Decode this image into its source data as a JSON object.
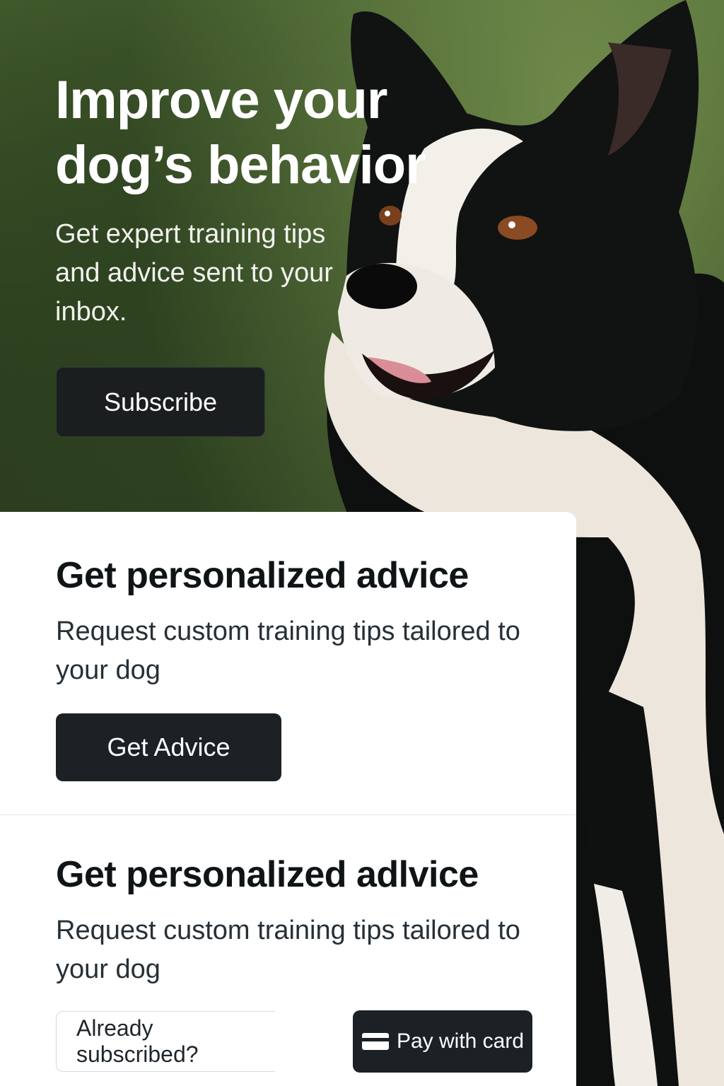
{
  "hero": {
    "title": "Improve your dog’s behavior",
    "subtitle": "Get expert training tips and advice sent to your inbox.",
    "subscribe_label": "Subscribe"
  },
  "advice_section": {
    "title": "Get personalized advice",
    "description": "Request custom training tips tailored to your dog",
    "button_label": "Get Advice"
  },
  "payment_section": {
    "title": "Get personalized adlvice",
    "description": "Request custom training tips tailored to your dog",
    "input_text": "Already subscribed?",
    "pay_label": "Pay with card",
    "pay_icon": "credit-card-icon"
  },
  "colors": {
    "button_dark": "#1b2124",
    "card_bg": "#ffffff",
    "hero_green": "#2b3c1d"
  }
}
